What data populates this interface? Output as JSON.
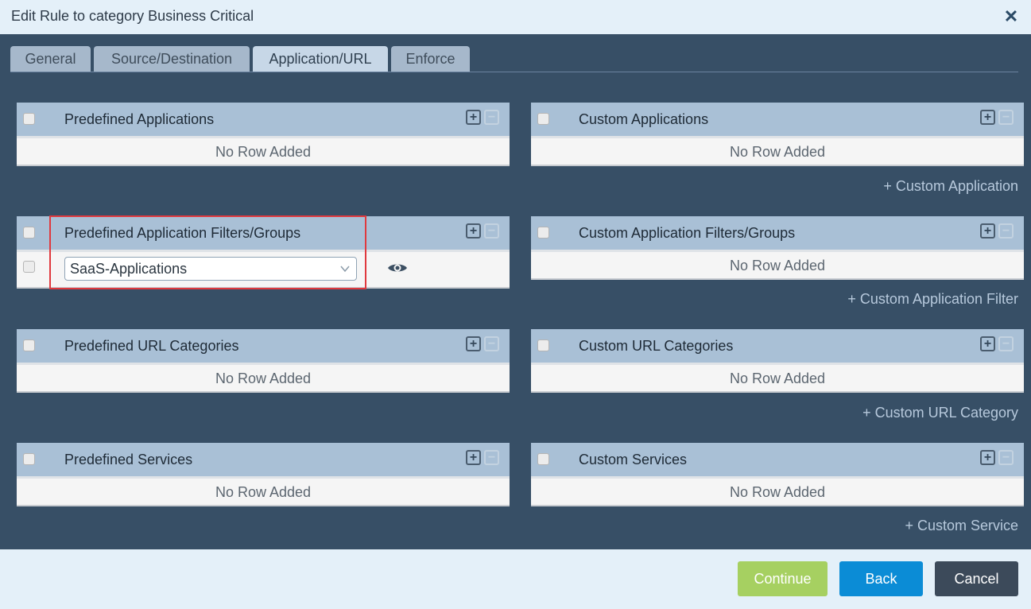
{
  "dialog": {
    "title": "Edit Rule to category Business Critical",
    "close_icon": "close-icon"
  },
  "tabs": [
    {
      "label": "General",
      "active": false
    },
    {
      "label": "Source/Destination",
      "active": false
    },
    {
      "label": "Application/URL",
      "active": true
    },
    {
      "label": "Enforce",
      "active": false
    }
  ],
  "sections": {
    "predefined_apps": {
      "header": "Predefined Applications",
      "empty": "No Row Added"
    },
    "custom_apps": {
      "header": "Custom Applications",
      "empty": "No Row Added",
      "add_link": "+ Custom Application"
    },
    "predefined_filters": {
      "header": "Predefined Application Filters/Groups",
      "row_value": "SaaS-Applications"
    },
    "custom_filters": {
      "header": "Custom Application Filters/Groups",
      "empty": "No Row Added",
      "add_link": "+ Custom Application Filter"
    },
    "predefined_url": {
      "header": "Predefined URL Categories",
      "empty": "No Row Added"
    },
    "custom_url": {
      "header": "Custom URL Categories",
      "empty": "No Row Added",
      "add_link": "+ Custom URL Category"
    },
    "predefined_services": {
      "header": "Predefined Services",
      "empty": "No Row Added"
    },
    "custom_services": {
      "header": "Custom Services",
      "empty": "No Row Added",
      "add_link": "+ Custom Service"
    }
  },
  "icons": {
    "add": "plus-icon",
    "remove": "minus-icon",
    "view": "eye-icon",
    "dropdown": "chevron-down-icon"
  },
  "controls": {
    "plus": "+",
    "minus": "−"
  },
  "footer": {
    "continue_label": "Continue",
    "back_label": "Back",
    "cancel_label": "Cancel"
  },
  "colors": {
    "panel_bg": "#374f66",
    "header_bg": "#a9c0d6",
    "continue": "#a6d061",
    "back": "#0b8cd6",
    "cancel": "#3c4a5a",
    "highlight": "#e0393e"
  }
}
